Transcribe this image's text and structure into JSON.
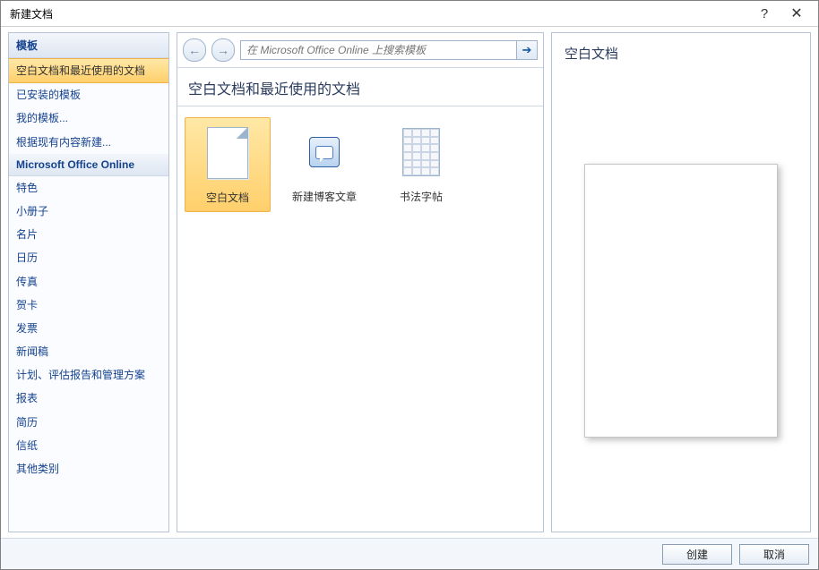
{
  "window": {
    "title": "新建文档"
  },
  "sidebar": {
    "heading_templates": "模板",
    "items_top": [
      "空白文档和最近使用的文档",
      "已安装的模板",
      "我的模板...",
      "根据现有内容新建..."
    ],
    "heading_online": "Microsoft Office Online",
    "items_online": [
      "特色",
      "小册子",
      "名片",
      "日历",
      "传真",
      "贺卡",
      "发票",
      "新闻稿",
      "计划、评估报告和管理方案",
      "报表",
      "简历",
      "信纸",
      "其他类别"
    ]
  },
  "search": {
    "placeholder": "在 Microsoft Office Online 上搜索模板"
  },
  "center": {
    "section_title": "空白文档和最近使用的文档",
    "templates": [
      {
        "label": "空白文档",
        "icon": "blank",
        "selected": true
      },
      {
        "label": "新建博客文章",
        "icon": "blog",
        "selected": false
      },
      {
        "label": "书法字帖",
        "icon": "calli",
        "selected": false
      }
    ]
  },
  "preview": {
    "title": "空白文档"
  },
  "footer": {
    "create": "创建",
    "cancel": "取消"
  }
}
